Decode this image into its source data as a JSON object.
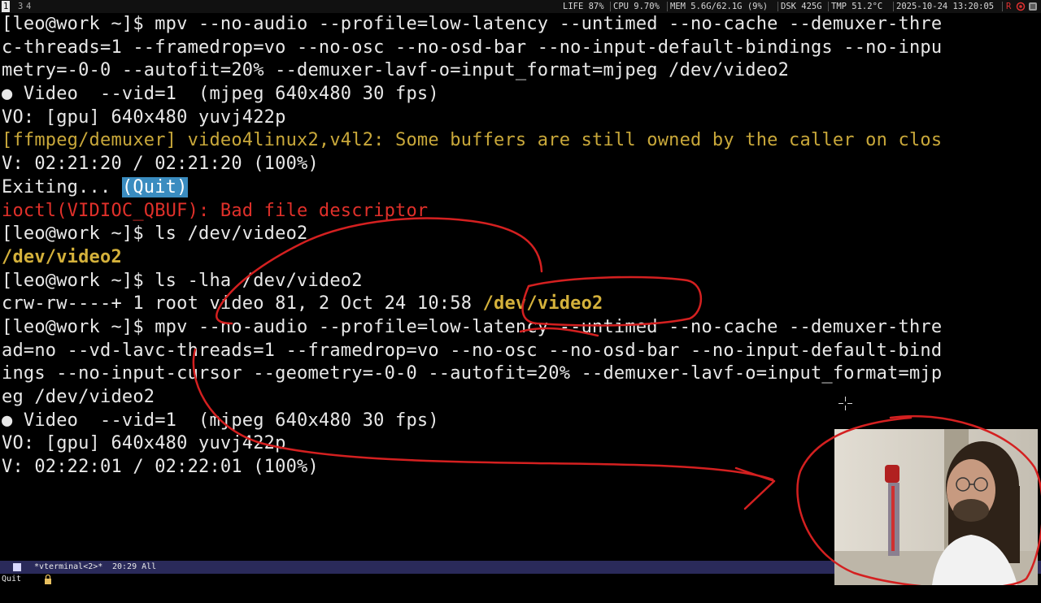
{
  "topbar": {
    "workspaces": [
      "1",
      "3",
      "4"
    ],
    "stats": {
      "life": "LIFE 87%",
      "cpu": "CPU 9.70%",
      "mem": "MEM 5.6G/62.1G (9%)",
      "dsk": "DSK 425G",
      "tmp": "TMP 51.2°C",
      "datetime": "2025-10-24 13:20:05",
      "rec": "R"
    }
  },
  "terminal": {
    "lines": [
      {
        "segments": [
          {
            "text": "[leo@work ~]$ mpv --no-audio --profile=low-latency --untimed --no-cache --demuxer-thre",
            "color": "white"
          }
        ]
      },
      {
        "segments": [
          {
            "text": "c-threads=1 --framedrop=vo --no-osc --no-osd-bar --no-input-default-bindings --no-inpu",
            "color": "white"
          }
        ]
      },
      {
        "segments": [
          {
            "text": "metry=-0-0 --autofit=20% --demuxer-lavf-o=input_format=mjpeg /dev/video2",
            "color": "white"
          }
        ]
      },
      {
        "segments": [
          {
            "text": "● Video  --vid=1  (mjpeg 640x480 30 fps)",
            "color": "white"
          }
        ]
      },
      {
        "segments": [
          {
            "text": "VO: [gpu] 640x480 yuvj422p",
            "color": "white"
          }
        ]
      },
      {
        "segments": [
          {
            "text": "[ffmpeg/demuxer] video4linux2,v4l2: Some buffers are still owned by the caller on clos",
            "color": "yellow"
          }
        ]
      },
      {
        "segments": [
          {
            "text": "V: 02:21:20 / 02:21:20 (100%)",
            "color": "white"
          }
        ]
      },
      {
        "segments": [
          {
            "text": "Exiting... ",
            "color": "white"
          },
          {
            "text": "(Quit)",
            "color": "highlight"
          }
        ]
      },
      {
        "segments": [
          {
            "text": "ioctl(VIDIOC_QBUF): Bad file descriptor",
            "color": "red"
          }
        ]
      },
      {
        "segments": [
          {
            "text": "[leo@work ~]$ ls /dev/video2",
            "color": "white"
          }
        ]
      },
      {
        "segments": [
          {
            "text": "/dev/video2",
            "color": "yellow-bold"
          }
        ]
      },
      {
        "segments": [
          {
            "text": "[leo@work ~]$ ls -lha /dev/video2",
            "color": "white"
          }
        ]
      },
      {
        "segments": [
          {
            "text": "crw-rw----+ 1 root video 81, 2 Oct 24 10:58 ",
            "color": "white"
          },
          {
            "text": "/dev/video2",
            "color": "yellow-bold"
          }
        ]
      },
      {
        "segments": [
          {
            "text": "[leo@work ~]$ mpv --no-audio --profile=low-latency --untimed --no-cache --demuxer-thre",
            "color": "white"
          }
        ]
      },
      {
        "segments": [
          {
            "text": "ad=no --vd-lavc-threads=1 --framedrop=vo --no-osc --no-osd-bar --no-input-default-bind",
            "color": "white"
          }
        ]
      },
      {
        "segments": [
          {
            "text": "ings --no-input-cursor --geometry=-0-0 --autofit=20% --demuxer-lavf-o=input_format=mjp",
            "color": "white"
          }
        ]
      },
      {
        "segments": [
          {
            "text": "eg /dev/video2",
            "color": "white"
          }
        ]
      },
      {
        "segments": [
          {
            "text": "● Video  --vid=1  (mjpeg 640x480 30 fps)",
            "color": "white"
          }
        ]
      },
      {
        "segments": [
          {
            "text": "VO: [gpu] 640x480 yuvj422p",
            "color": "white"
          }
        ]
      },
      {
        "segments": [
          {
            "text": "V: 02:22:01 / 02:22:01 (100%)",
            "color": "white"
          }
        ]
      }
    ]
  },
  "modeline": {
    "buffer": "*vterminal<2>*",
    "position": "20:29 All"
  },
  "minibuffer": {
    "text": "Quit"
  },
  "colors": {
    "white": "#e8e8e8",
    "yellow": "#c9a83a",
    "yellow_bold": "#d4b13b",
    "red": "#e0302a",
    "highlight": "#3a8cc0",
    "annotation": "#d42020",
    "modeline_bg": "#2a2a5a"
  },
  "icons": [
    "terminal-icon",
    "lock-icon",
    "recording-icon",
    "crosshair-cursor-icon"
  ]
}
